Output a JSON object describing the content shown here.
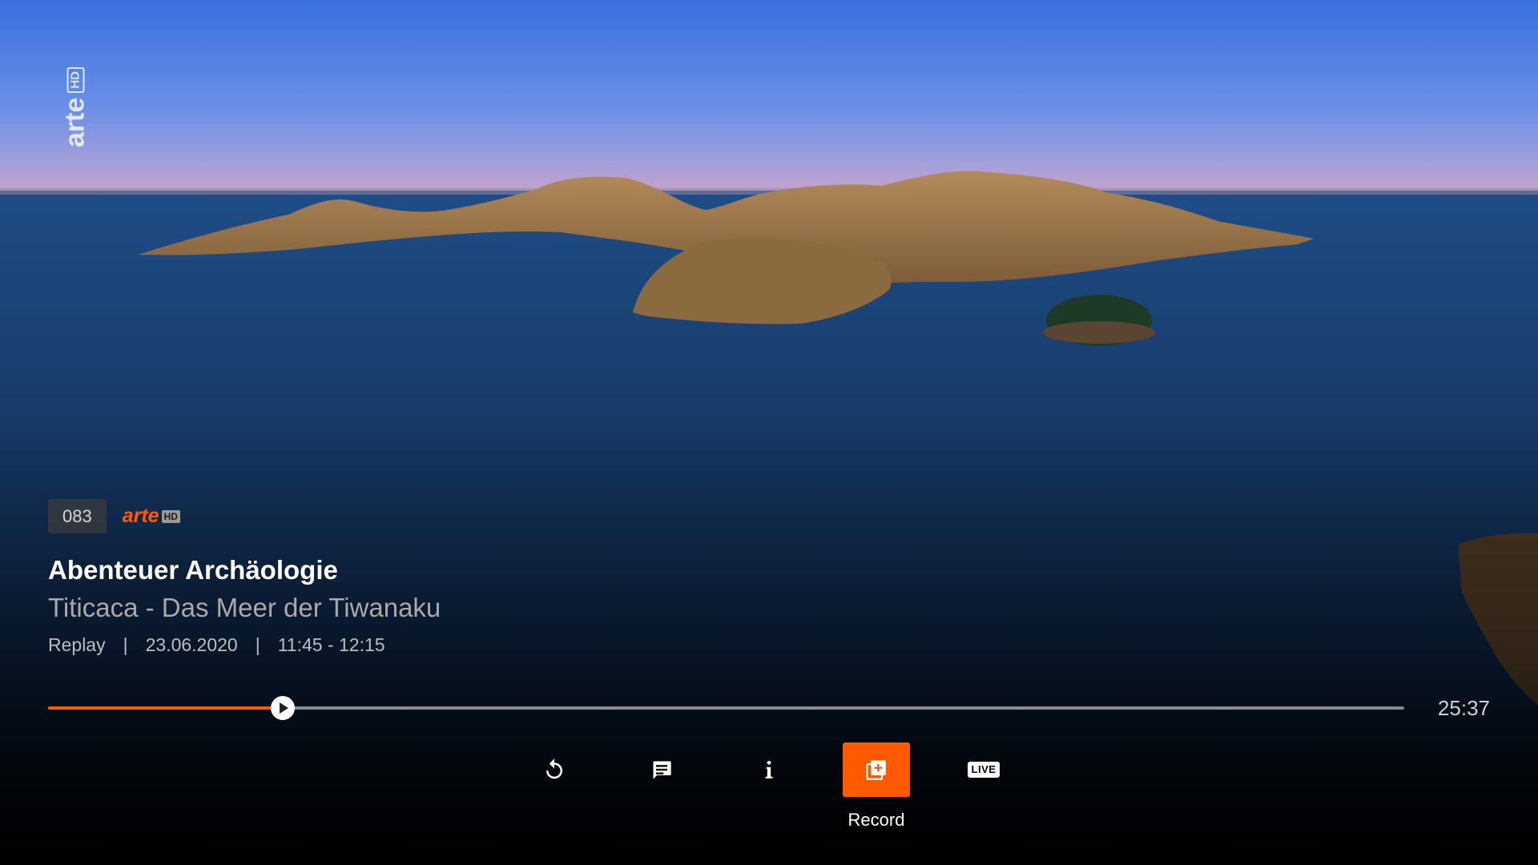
{
  "colors": {
    "accent": "#ff5a00",
    "track": "#8a8a8a",
    "text_primary": "#ffffff",
    "text_secondary": "#a9a9a9"
  },
  "watermark": {
    "logo_text": "arte",
    "logo_hd": "HD"
  },
  "channel": {
    "number": "083",
    "logo_text": "arte",
    "logo_hd": "HD"
  },
  "program": {
    "title": "Abenteuer Archäologie",
    "episode": "Titicaca - Das Meer der Tiwanaku",
    "mode": "Replay",
    "separator": "|",
    "date": "23.06.2020",
    "time_range": "11:45 - 12:15"
  },
  "playback": {
    "progress_fraction": 0.173,
    "duration": "25:37"
  },
  "controls": [
    {
      "id": "replay",
      "icon": "replay-icon",
      "active": false
    },
    {
      "id": "subtitles",
      "icon": "subtitles-icon",
      "active": false
    },
    {
      "id": "info",
      "icon": "info-icon",
      "active": false
    },
    {
      "id": "record",
      "icon": "record-icon",
      "active": true,
      "label": "Record"
    },
    {
      "id": "live",
      "icon": "live-icon",
      "active": false,
      "badge_text": "LIVE"
    }
  ]
}
